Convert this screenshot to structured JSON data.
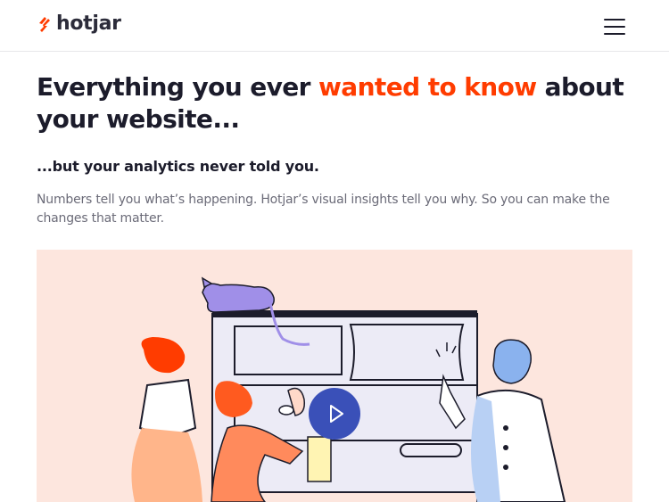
{
  "header": {
    "logo_text": "hotjar",
    "logo_icon": "hotjar-flame-icon",
    "menu_icon": "hamburger-menu-icon"
  },
  "hero": {
    "headline_part1": "Everything you ever ",
    "headline_accent": "wanted to know",
    "headline_part2": " about your website...",
    "subheading": "...but your analytics never told you.",
    "body": "Numbers tell you what’s happening. Hotjar’s visual insights tell you why. So you can make the changes that matter.",
    "video_play_icon": "play-icon"
  },
  "colors": {
    "accent": "#ff3c00",
    "text": "#1c1c2b",
    "muted": "#6b6b78",
    "hero_bg": "#fde6de",
    "play_button": "#3a50b8"
  }
}
